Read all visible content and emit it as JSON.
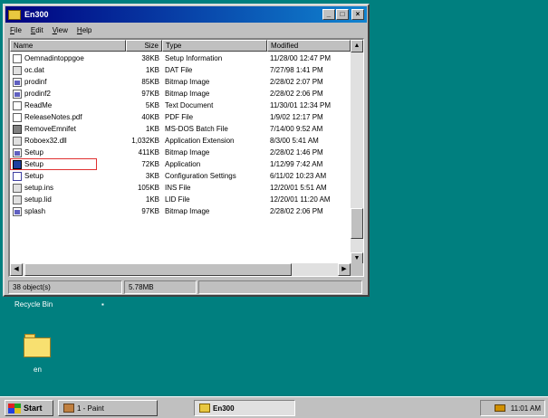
{
  "window": {
    "title": "En300",
    "menu": [
      "File",
      "Edit",
      "View",
      "Help"
    ],
    "columns": [
      "Name",
      "Size",
      "Type",
      "Modified"
    ],
    "files": [
      {
        "name": "Oemnadintoppgoe",
        "size": "38KB",
        "type": "Setup Information",
        "modified": "11/28/00 12:47 PM",
        "icon": "doc"
      },
      {
        "name": "oc.dat",
        "size": "1KB",
        "type": "DAT File",
        "modified": "7/27/98 1:41 PM",
        "icon": "sys"
      },
      {
        "name": "prodinf",
        "size": "85KB",
        "type": "Bitmap Image",
        "modified": "2/28/02 2:07 PM",
        "icon": "bmp"
      },
      {
        "name": "prodinf2",
        "size": "97KB",
        "type": "Bitmap Image",
        "modified": "2/28/02 2:06 PM",
        "icon": "bmp"
      },
      {
        "name": "ReadMe",
        "size": "5KB",
        "type": "Text Document",
        "modified": "11/30/01 12:34 PM",
        "icon": "doc"
      },
      {
        "name": "ReleaseNotes.pdf",
        "size": "40KB",
        "type": "PDF File",
        "modified": "1/9/02 12:17 PM",
        "icon": "doc"
      },
      {
        "name": "RemoveEmnifet",
        "size": "1KB",
        "type": "MS-DOS Batch File",
        "modified": "7/14/00 9:52 AM",
        "icon": "app"
      },
      {
        "name": "Roboex32.dll",
        "size": "1,032KB",
        "type": "Application Extension",
        "modified": "8/3/00 5:41 AM",
        "icon": "sys"
      },
      {
        "name": "Setup",
        "size": "411KB",
        "type": "Bitmap Image",
        "modified": "2/28/02 1:46 PM",
        "icon": "bmp"
      },
      {
        "name": "Setup",
        "size": "72KB",
        "type": "Application",
        "modified": "1/12/99 7:42 AM",
        "icon": "setupapp",
        "highlight": true
      },
      {
        "name": "Setup",
        "size": "3KB",
        "type": "Configuration Settings",
        "modified": "6/11/02 10:23 AM",
        "icon": "cfg"
      },
      {
        "name": "setup.ins",
        "size": "105KB",
        "type": "INS File",
        "modified": "12/20/01 5:51 AM",
        "icon": "sys"
      },
      {
        "name": "setup.lid",
        "size": "1KB",
        "type": "LID File",
        "modified": "12/20/01 11:20 AM",
        "icon": "sys"
      },
      {
        "name": "splash",
        "size": "97KB",
        "type": "Bitmap Image",
        "modified": "2/28/02 2:06 PM",
        "icon": "bmp"
      }
    ],
    "status": {
      "objects": "38 object(s)",
      "size": "5.78MB"
    }
  },
  "desktop": {
    "recycle_bin": "Recycle Bin",
    "folder_label": "en"
  },
  "taskbar": {
    "start": "Start",
    "paint": "1 - Paint",
    "active": "En300",
    "clock": "11:01 AM"
  },
  "colors": {
    "desktop": "#007f7f",
    "titlebar": "#000080",
    "highlight": "#e03030"
  }
}
